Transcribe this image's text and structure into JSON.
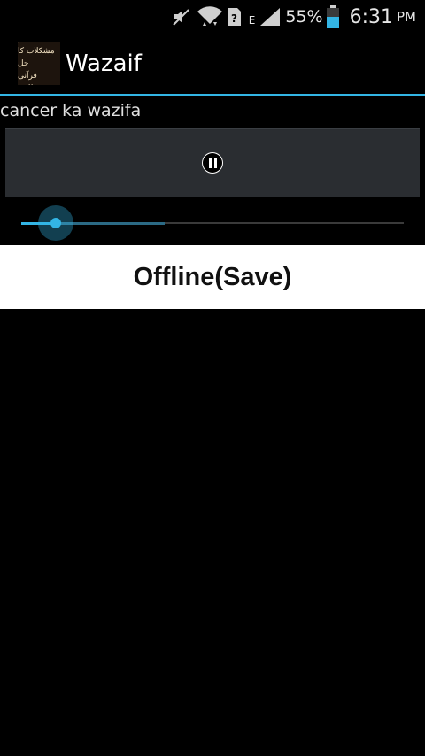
{
  "status_bar": {
    "icons": [
      "mute-icon",
      "wifi-icon",
      "unknown-sim-icon",
      "signal-icon",
      "battery-icon"
    ],
    "data_type": "E",
    "battery_percent": "55%",
    "time": "6:31",
    "ampm": "PM"
  },
  "action_bar": {
    "logo_lines": [
      "تمام مشکلات کا حل",
      "قرآنی وظائف"
    ],
    "title": "Wazaif"
  },
  "player": {
    "track_title": "cancer ka wazifa",
    "state": "playing",
    "control_icon": "pause-icon",
    "progress_fraction": 0.09,
    "buffered_fraction": 0.375
  },
  "actions": {
    "offline_label": "Offline(Save)"
  },
  "colors": {
    "accent": "#33b5e5",
    "background": "#000000",
    "panel": "#2a2d31",
    "button_bg": "#ffffff"
  }
}
